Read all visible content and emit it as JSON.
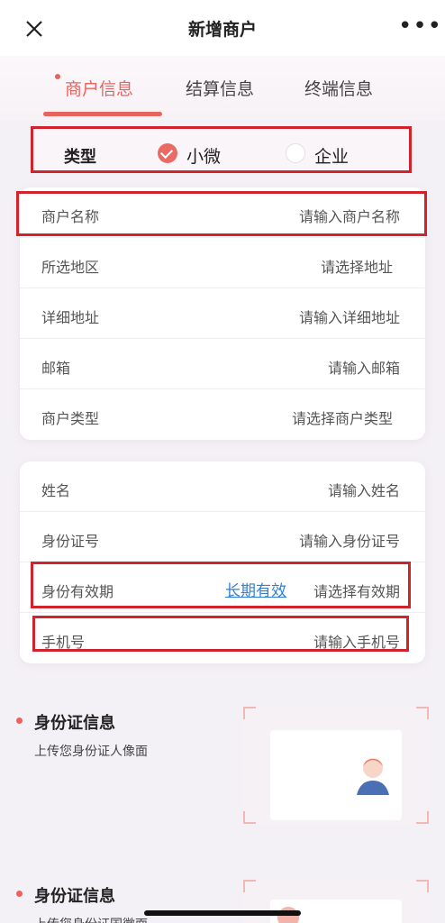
{
  "header": {
    "title": "新增商户",
    "close_icon": "close-icon",
    "more_icon": "more-icon",
    "more_glyph": "•••"
  },
  "tabs": [
    {
      "label": "商户信息",
      "active": true
    },
    {
      "label": "结算信息",
      "active": false
    },
    {
      "label": "终端信息",
      "active": false
    }
  ],
  "type_selector": {
    "label": "类型",
    "options": [
      {
        "label": "小微",
        "selected": true
      },
      {
        "label": "企业",
        "selected": false
      }
    ]
  },
  "merchant_form": [
    {
      "label": "商户名称",
      "placeholder": "请输入商户名称"
    },
    {
      "label": "所选地区",
      "placeholder": "请选择地址"
    },
    {
      "label": "详细地址",
      "placeholder": "请输入详细地址"
    },
    {
      "label": "邮箱",
      "placeholder": "请输入邮箱"
    },
    {
      "label": "商户类型",
      "placeholder": "请选择商户类型"
    }
  ],
  "person_form": [
    {
      "label": "姓名",
      "placeholder": "请输入姓名"
    },
    {
      "label": "身份证号",
      "placeholder": "请输入身份证号"
    },
    {
      "label": "身份有效期",
      "placeholder": "请选择有效期",
      "link": "长期有效"
    },
    {
      "label": "手机号",
      "placeholder": "请输入手机号"
    }
  ],
  "id_sections": [
    {
      "title": "身份证信息",
      "subtitle": "上传您身份证人像面"
    },
    {
      "title": "身份证信息",
      "subtitle": "上传您身份证国徽面"
    }
  ],
  "colors": {
    "accent": "#e8655f",
    "highlight_border": "#d0232b",
    "link": "#2f7fd6"
  }
}
